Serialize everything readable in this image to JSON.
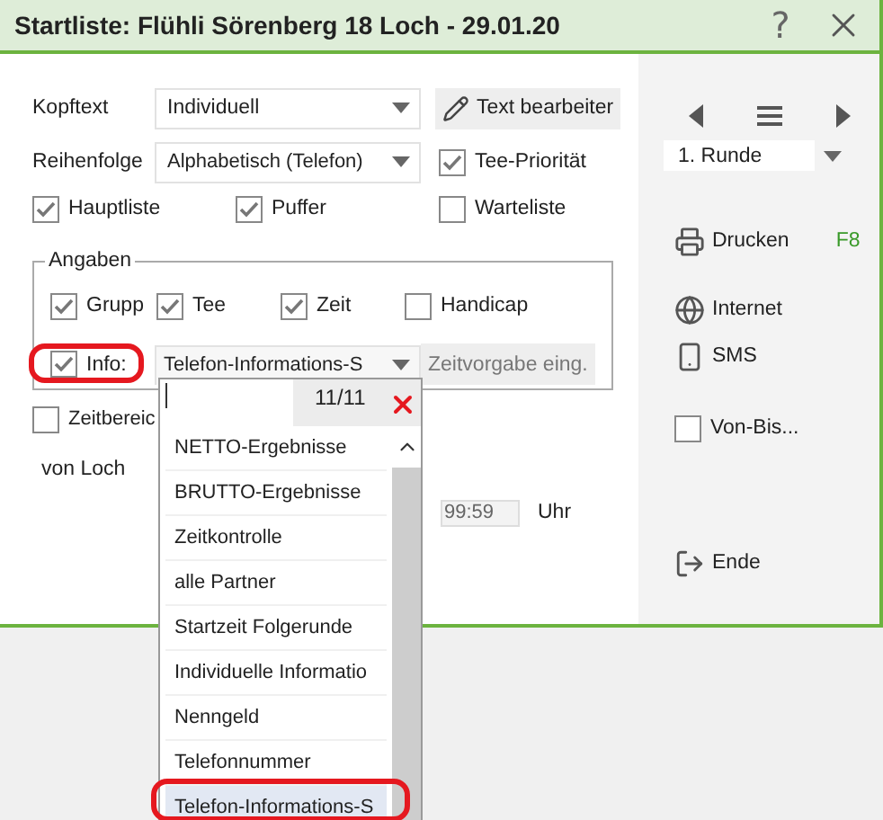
{
  "window": {
    "title": "Startliste: Flühli Sörenberg 18 Loch - 29.01.20",
    "help": "?"
  },
  "form": {
    "header": {
      "label": "Kopftext",
      "value": "Individuell"
    },
    "edit_button": "Text bearbeiter",
    "order": {
      "label": "Reihenfolge",
      "value": "Alphabetisch (Telefon)"
    },
    "tee_priority": {
      "label": "Tee-Priorität",
      "checked": true
    },
    "lists": [
      {
        "label": "Hauptliste",
        "checked": true
      },
      {
        "label": "Puffer",
        "checked": true
      },
      {
        "label": "Warteliste",
        "checked": false
      }
    ]
  },
  "details": {
    "title": "Angaben",
    "options": [
      {
        "label": "Grupp",
        "checked": true
      },
      {
        "label": "Tee",
        "checked": true
      },
      {
        "label": "Zeit",
        "checked": true
      },
      {
        "label": "Handicap",
        "checked": false
      }
    ],
    "info": {
      "label": "Info:",
      "checked": true,
      "value": "Telefon-Informations-S",
      "highlighted": true
    },
    "time_button": "Zeitvorgabe eing."
  },
  "time_range": {
    "label": "Zeitbereic",
    "checked": false
  },
  "from_hole": "von Loch",
  "time": {
    "value": "99:59",
    "unit": "Uhr"
  },
  "dropdown": {
    "counter": "11/11",
    "items": [
      {
        "label": "NETTO-Ergebnisse",
        "selected": false,
        "highlighted": false
      },
      {
        "label": "BRUTTO-Ergebnisse",
        "selected": false,
        "highlighted": false
      },
      {
        "label": "Zeitkontrolle",
        "selected": false,
        "highlighted": false
      },
      {
        "label": "alle Partner",
        "selected": false,
        "highlighted": false
      },
      {
        "label": "Startzeit Folgerunde",
        "selected": false,
        "highlighted": false
      },
      {
        "label": "Individuelle Informatio",
        "selected": false,
        "highlighted": false
      },
      {
        "label": "Nenngeld",
        "selected": false,
        "highlighted": false
      },
      {
        "label": "Telefonnummer",
        "selected": false,
        "highlighted": false
      },
      {
        "label": "Telefon-Informations-S",
        "selected": true,
        "highlighted": true
      }
    ]
  },
  "sidebar": {
    "round": "1. Runde",
    "actions": [
      {
        "kind": "button",
        "label": "Drucken",
        "shortcut": "F8"
      },
      {
        "kind": "button",
        "label": "Internet"
      },
      {
        "kind": "button",
        "label": "SMS"
      },
      {
        "kind": "checkbox",
        "label": "Von-Bis...",
        "checked": false
      },
      {
        "kind": "button",
        "label": "Ende"
      }
    ]
  }
}
